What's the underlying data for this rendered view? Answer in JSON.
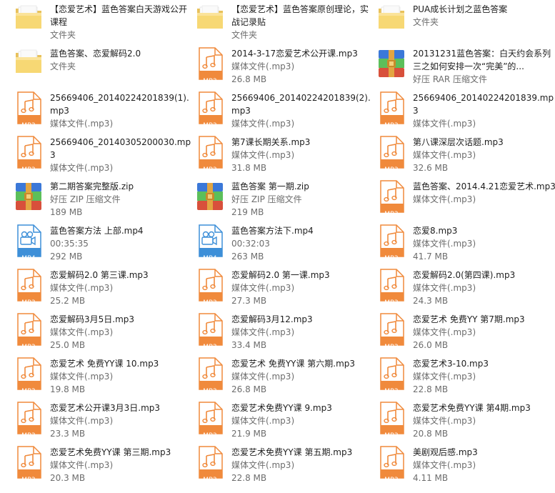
{
  "colors": {
    "mp3_accent": "#f08a3c",
    "mp4_accent": "#3d8fd8",
    "folder": "#f5d36b",
    "text_primary": "#1e1e1e",
    "text_secondary": "#6d6d6d"
  },
  "items": [
    {
      "icon": "folder",
      "name": "【恋爱艺术】蓝色答案白天游戏公开课程",
      "line2": "文件夹",
      "line3": ""
    },
    {
      "icon": "folder",
      "name": "【恋爱艺术】蓝色答案原创理论，实战记录贴",
      "line2": "文件夹",
      "line3": ""
    },
    {
      "icon": "folder",
      "name": "PUA成长计划之蓝色答案",
      "line2": "文件夹",
      "line3": ""
    },
    {
      "icon": "folder",
      "name": "蓝色答案、恋爱解码2.0",
      "line2": "文件夹",
      "line3": ""
    },
    {
      "icon": "mp3",
      "badge": "MP3",
      "name": "2014-3-17恋爱艺术公开课.mp3",
      "line2": "媒体文件(.mp3)",
      "line3": "26.8 MB"
    },
    {
      "icon": "rar",
      "name": "20131231蓝色答案：白天约会系列三之如何安排一次“完美”的...",
      "line2": "好压 RAR 压缩文件",
      "line3": ""
    },
    {
      "icon": "mp3",
      "badge": "MP3",
      "name": "25669406_20140224201839(1).mp3",
      "line2": "媒体文件(.mp3)",
      "line3": ""
    },
    {
      "icon": "mp3",
      "badge": "MP3",
      "name": "25669406_20140224201839(2).mp3",
      "line2": "媒体文件(.mp3)",
      "line3": ""
    },
    {
      "icon": "mp3",
      "badge": "MP3",
      "name": "25669406_20140224201839.mp3",
      "line2": "媒体文件(.mp3)",
      "line3": ""
    },
    {
      "icon": "mp3",
      "badge": "MP3",
      "name": "25669406_20140305200030.mp3",
      "line2": "媒体文件(.mp3)",
      "line3": ""
    },
    {
      "icon": "mp3",
      "badge": "MP3",
      "name": "第7课长期关系.mp3",
      "line2": "媒体文件(.mp3)",
      "line3": "31.8 MB"
    },
    {
      "icon": "mp3",
      "badge": "MP3",
      "name": "第八课深层次话题.mp3",
      "line2": "媒体文件(.mp3)",
      "line3": "32.6 MB"
    },
    {
      "icon": "zip",
      "name": "第二期答案完整版.zip",
      "line2": "好压 ZIP 压缩文件",
      "line3": "189 MB"
    },
    {
      "icon": "zip",
      "name": "蓝色答案 第一期.zip",
      "line2": "好压 ZIP 压缩文件",
      "line3": "219 MB"
    },
    {
      "icon": "mp3",
      "badge": "MP3",
      "name": "蓝色答案、2014.4.21恋爱艺术.mp3",
      "line2": "媒体文件(.mp3)",
      "line3": ""
    },
    {
      "icon": "mp4",
      "badge": "MP4",
      "name": "蓝色答案方法 上部.mp4",
      "line2": "00:35:35",
      "line3": "292 MB"
    },
    {
      "icon": "mp4",
      "badge": "MP4",
      "name": "蓝色答案方法下.mp4",
      "line2": "00:32:03",
      "line3": "263 MB"
    },
    {
      "icon": "mp3",
      "badge": "MP3",
      "name": "恋爱8.mp3",
      "line2": "媒体文件(.mp3)",
      "line3": "41.7 MB"
    },
    {
      "icon": "mp3",
      "badge": "MP3",
      "name": "恋爱解码2.0 第三课.mp3",
      "line2": "媒体文件(.mp3)",
      "line3": "25.2 MB"
    },
    {
      "icon": "mp3",
      "badge": "MP3",
      "name": "恋爱解码2.0 第一课.mp3",
      "line2": "媒体文件(.mp3)",
      "line3": "27.3 MB"
    },
    {
      "icon": "mp3",
      "badge": "MP3",
      "name": "恋爱解码2.0(第四课).mp3",
      "line2": "媒体文件(.mp3)",
      "line3": "24.3 MB"
    },
    {
      "icon": "mp3",
      "badge": "MP3",
      "name": "恋爱解码3月5日.mp3",
      "line2": "媒体文件(.mp3)",
      "line3": "25.0 MB"
    },
    {
      "icon": "mp3",
      "badge": "MP3",
      "name": "恋爱解码3月12.mp3",
      "line2": "媒体文件(.mp3)",
      "line3": "33.4 MB"
    },
    {
      "icon": "mp3",
      "badge": "MP3",
      "name": "恋爱艺术 免费YY 第7期.mp3",
      "line2": "媒体文件(.mp3)",
      "line3": "26.0 MB"
    },
    {
      "icon": "mp3",
      "badge": "MP3",
      "name": "恋爱艺术 免费YY课 10.mp3",
      "line2": "媒体文件(.mp3)",
      "line3": "19.8 MB"
    },
    {
      "icon": "mp3",
      "badge": "MP3",
      "name": "恋爱艺术 免费YY课 第六期.mp3",
      "line2": "媒体文件(.mp3)",
      "line3": "26.8 MB"
    },
    {
      "icon": "mp3",
      "badge": "MP3",
      "name": "恋爱艺术3-10.mp3",
      "line2": "媒体文件(.mp3)",
      "line3": "22.8 MB"
    },
    {
      "icon": "mp3",
      "badge": "MP3",
      "name": "恋爱艺术公开课3月3日.mp3",
      "line2": "媒体文件(.mp3)",
      "line3": "23.3 MB"
    },
    {
      "icon": "mp3",
      "badge": "MP3",
      "name": "恋爱艺术免费YY课 9.mp3",
      "line2": "媒体文件(.mp3)",
      "line3": "21.9 MB"
    },
    {
      "icon": "mp3",
      "badge": "MP3",
      "name": "恋爱艺术免费YY课 第4期.mp3",
      "line2": "媒体文件(.mp3)",
      "line3": "20.8 MB"
    },
    {
      "icon": "mp3",
      "badge": "MP3",
      "name": "恋爱艺术免费YY课 第三期.mp3",
      "line2": "媒体文件(.mp3)",
      "line3": "20.3 MB"
    },
    {
      "icon": "mp3",
      "badge": "MP3",
      "name": "恋爱艺术免费YY课 第五期.mp3",
      "line2": "媒体文件(.mp3)",
      "line3": "22.8 MB"
    },
    {
      "icon": "mp3",
      "badge": "MP3",
      "name": "美剧观后感.mp3",
      "line2": "媒体文件(.mp3)",
      "line3": "4.11 MB"
    }
  ]
}
